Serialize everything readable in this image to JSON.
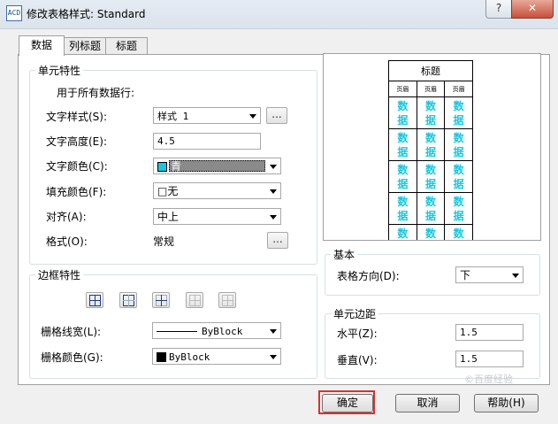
{
  "window": {
    "title": "修改表格样式: Standard",
    "icon": "AutoCAD"
  },
  "titlebar": {
    "help_label": "?",
    "close_label": "✕"
  },
  "tabs": [
    {
      "label": "数据"
    },
    {
      "label": "列标题"
    },
    {
      "label": "标题"
    }
  ],
  "cell_props": {
    "group_title": "单元特性",
    "apply_all": "用于所有数据行:",
    "text_style_label": "文字样式(S):",
    "text_style_value": "样式 1",
    "text_height_label": "文字高度(E):",
    "text_height_value": "4.5",
    "text_color_label": "文字颜色(C):",
    "text_color_value": "青",
    "text_color_hex": "#19c6e0",
    "fill_color_label": "填充颜色(F):",
    "fill_color_value": "□无",
    "align_label": "对齐(A):",
    "align_value": "中上",
    "format_label": "格式(O):",
    "format_value": "常规",
    "dots": "..."
  },
  "border_props": {
    "group_title": "边框特性",
    "lineweight_label": "栅格线宽(L):",
    "lineweight_value": "ByBlock",
    "color_label": "栅格颜色(G):",
    "color_value": "ByBlock"
  },
  "preview": {
    "title": "标题",
    "header": [
      "页眉",
      "页眉",
      "页眉"
    ],
    "cell_text": "数据"
  },
  "basic": {
    "group_title": "基本",
    "direction_label": "表格方向(D):",
    "direction_value": "下"
  },
  "margins": {
    "group_title": "单元边距",
    "horizontal_label": "水平(Z):",
    "horizontal_value": "1.5",
    "vertical_label": "垂直(V):",
    "vertical_value": "1.5"
  },
  "buttons": {
    "ok": "确定",
    "cancel": "取消",
    "help": "帮助(H)"
  },
  "watermark": "©百度经验"
}
